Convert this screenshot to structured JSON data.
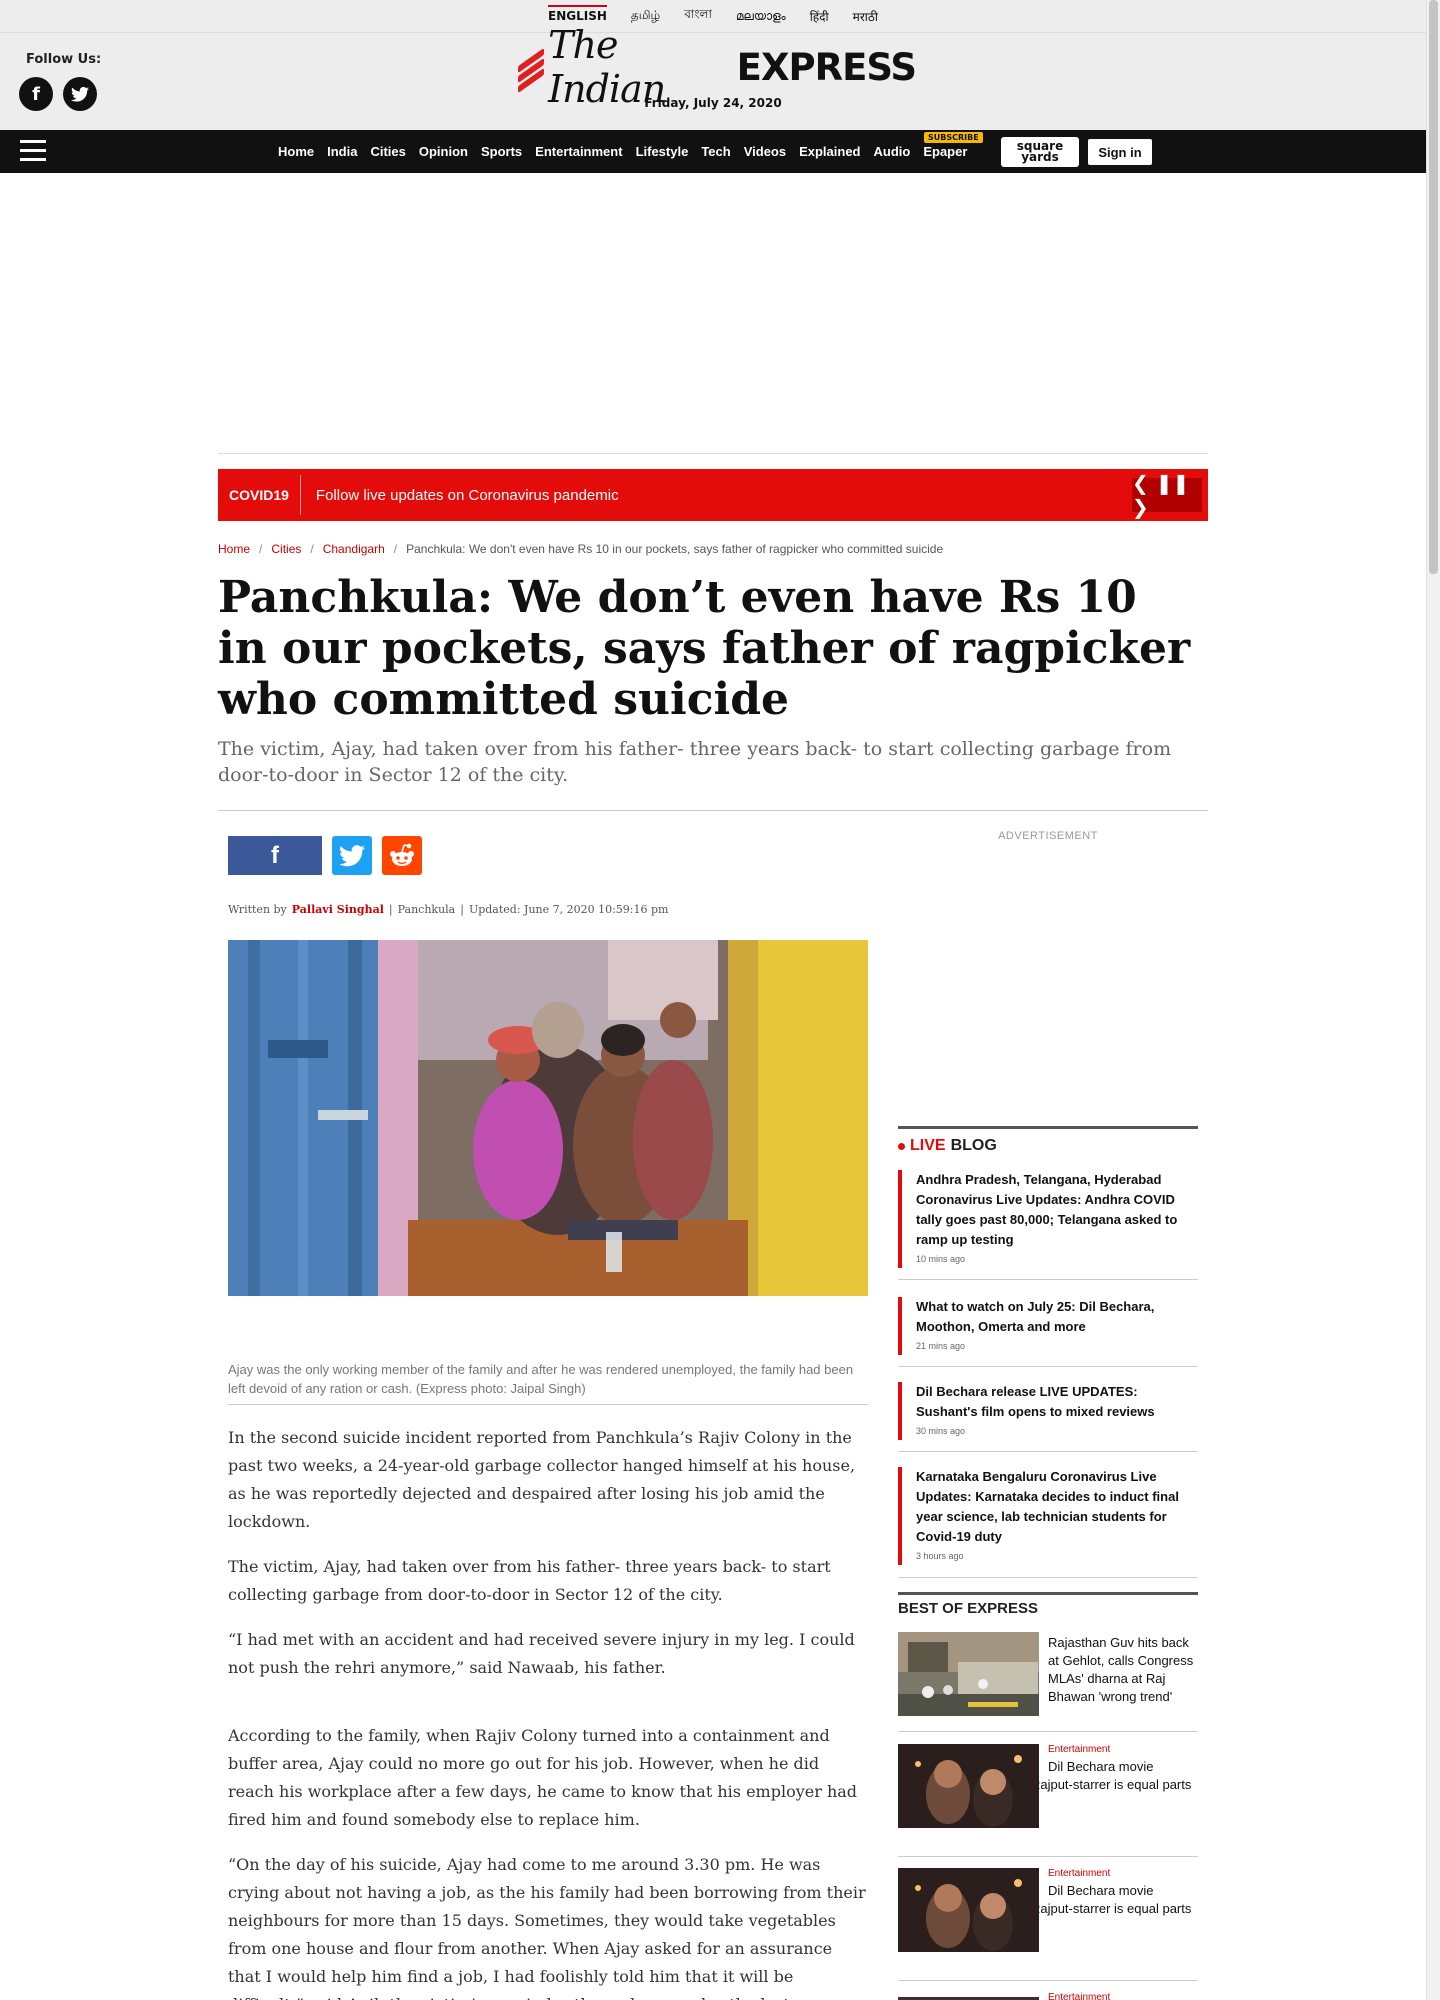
{
  "languages": [
    "ENGLISH",
    "தமிழ்",
    "বাংলা",
    "മലയാളം",
    "हिंदी",
    "मराठी"
  ],
  "follow_label": "Follow Us:",
  "logo": {
    "part1": "The Indian",
    "part2": "EXPRESS"
  },
  "date": "Friday, July 24, 2020",
  "nav": {
    "items": [
      "Home",
      "India",
      "Cities",
      "Opinion",
      "Sports",
      "Entertainment",
      "Lifestyle",
      "Tech",
      "Videos",
      "Explained",
      "Audio",
      "Epaper"
    ],
    "subscribe_tag": "SUBSCRIBE",
    "squareyards": "square yards",
    "signin": "Sign in"
  },
  "covid": {
    "tag": "COVID19",
    "message": "Follow live updates on Coronavirus pandemic",
    "controls": "❮ ❚❚ ❯"
  },
  "breadcrumb": [
    "Home",
    "Cities",
    "Chandigarh",
    "Panchkula: We don't even have Rs 10 in our pockets, says father of ragpicker who committed suicide"
  ],
  "article": {
    "headline": "Panchkula: We don’t even have Rs 10 in our pockets, says father of ragpicker who committed suicide",
    "standfirst": "The victim, Ajay, had taken over from his father- three years back- to start collecting garbage from door-to-door in Sector 12 of the city.",
    "byline_prefix": "Written by",
    "author": "Pallavi Singhal",
    "location": "Panchkula",
    "updated": "Updated: June 7, 2020 10:59:16 pm",
    "caption": "Ajay was the only working member of the family and after he was rendered unemployed, the family had been left devoid of any ration or cash. (Express photo: Jaipal Singh)",
    "paragraphs": [
      "In the second suicide incident reported from Panchkula’s Rajiv Colony in the past two weeks, a 24-year-old garbage collector hanged himself at his house, as he was reportedly dejected and despaired after losing his job amid the lockdown.",
      "The victim, Ajay, had taken over from his father- three years back- to start collecting garbage from door-to-door in Sector 12 of the city.",
      "“I had met with an accident and had received severe injury in my leg. I could not push the rehri anymore,” said Nawaab, his father.",
      "According to the family, when Rajiv Colony turned into a containment and buffer area, Ajay could no more go out for his job. However, when he did reach his workplace after a few days, he came to know that his employer had fired him and found somebody else to replace him.",
      "“On the day of his suicide, Ajay had come to me around 3.30 pm. He was crying about not having a job, as the his family had been borrowing from their neighbours for more than 15 days. Sometimes, they would take vegetables from one house and flour from another. When Ajay asked for an assurance that I would help him find a job, I had foolishly told him that it will be difficult,” said Anil, the victim’s cousin brother, who was also the last person to have spoken to him. Ajay was found dead"
    ]
  },
  "sidebar": {
    "ad_label": "ADVERTISEMENT",
    "live_label": "LIVE",
    "blog_label": "BLOG",
    "live_items": [
      {
        "title": "Andhra Pradesh, Telangana, Hyderabad Coronavirus Live Updates: Andhra COVID tally goes past 80,000; Telangana asked to ramp up testing",
        "ago": "10 mins ago"
      },
      {
        "title": "What to watch on July 25: Dil Bechara, Moothon, Omerta and more",
        "ago": "21 mins ago"
      },
      {
        "title": "Dil Bechara release LIVE UPDATES: Sushant's film opens to mixed reviews",
        "ago": "30 mins ago"
      },
      {
        "title": "Karnataka Bengaluru Coronavirus Live Updates: Karnataka decides to induct final year science, lab technician students for Covid-19 duty",
        "ago": "3 hours ago"
      }
    ],
    "best_label": "BEST OF EXPRESS",
    "best_items": [
      {
        "category": "",
        "title": "Rajasthan Guv hits back at Gehlot, calls Congress MLAs' dharna at Raj Bhawan 'wrong trend'"
      },
      {
        "category": "Entertainment",
        "title": "Dil Bechara movie review: Sushant Singh Rajput-starrer is equal parts dirge and catharsis"
      },
      {
        "category": "Entertainment",
        "title": "Dil Bechara movie review: Sushant Singh Rajput-starrer is equal parts dirge and catharsis"
      },
      {
        "category": "Entertainment",
        "title": ""
      }
    ]
  },
  "colors": {
    "brand_red": "#e40b0b",
    "nav_bg": "#111111",
    "facebook": "#3b5998",
    "twitter": "#1da1f2",
    "reddit": "#ff4500"
  },
  "icons": [
    "hamburger-menu-icon",
    "search-icon",
    "facebook-icon",
    "twitter-icon",
    "reddit-icon"
  ]
}
